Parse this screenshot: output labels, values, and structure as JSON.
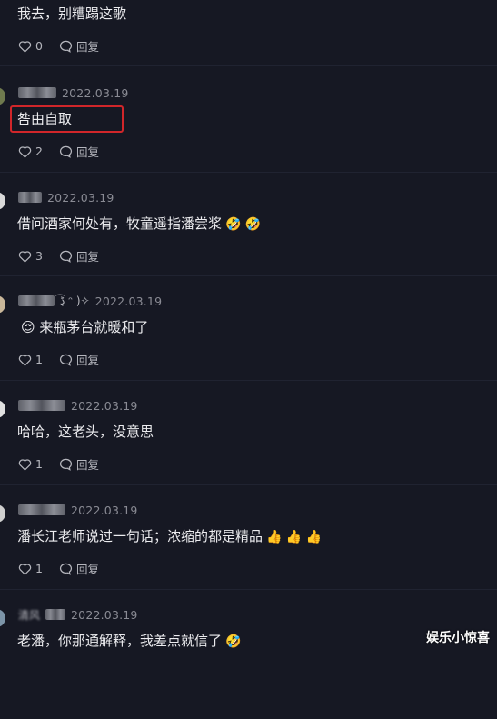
{
  "comments": [
    {
      "name_suffix": "",
      "date": "",
      "text": "我去，别糟蹋这歌",
      "emoji": "",
      "likes": "0",
      "reply_label": "回复"
    },
    {
      "name_suffix": "",
      "date": "2022.03.19",
      "text": "咎由自取",
      "emoji": "",
      "likes": "2",
      "reply_label": "回复"
    },
    {
      "name_suffix": "",
      "date": "2022.03.19",
      "text": "借问酒家何处有，牧童遥指潘尝浆",
      "emoji": "🤣 🤣",
      "likes": "3",
      "reply_label": "回复"
    },
    {
      "name_suffix": "ڋ͡ ᵔ )✧",
      "date": "2022.03.19",
      "text": "😌 来瓶茅台就暖和了",
      "emoji": "",
      "likes": "1",
      "reply_label": "回复"
    },
    {
      "name_suffix": "",
      "date": "2022.03.19",
      "text": "哈哈，这老头，没意思",
      "emoji": "",
      "likes": "1",
      "reply_label": "回复"
    },
    {
      "name_suffix": "",
      "date": "2022.03.19",
      "text": "潘长江老师说过一句话；浓缩的都是精品",
      "emoji": "👍 👍 👍",
      "likes": "1",
      "reply_label": "回复"
    },
    {
      "name_suffix": "清风",
      "date": "2022.03.19",
      "text": "老潘，你那通解释，我差点就信了",
      "emoji": "🤣",
      "likes": "",
      "reply_label": ""
    }
  ],
  "watermark": "娱乐小惊喜",
  "colors": {
    "background": "#161823",
    "highlight": "#d1262a"
  }
}
